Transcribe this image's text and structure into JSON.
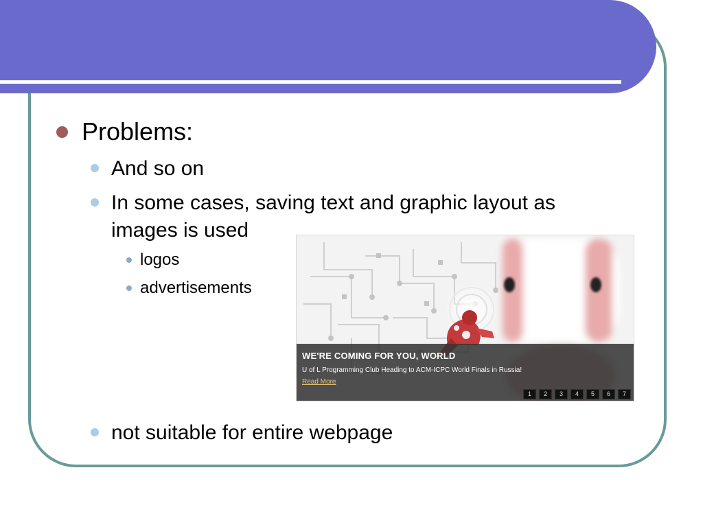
{
  "slide": {
    "bullets": {
      "problems": "Problems:",
      "and_so_on": "And so on",
      "images_used": "In some cases, saving text and graphic layout as images is used",
      "logos": "logos",
      "advertisements": "advertisements",
      "not_suitable": "not suitable for entire webpage"
    },
    "colors": {
      "title_band": "#6a6acc",
      "frame_border": "#6a9a9a",
      "level1_bullet": "#a05a5a",
      "level2_bullet": "#a9cce8"
    }
  },
  "banner": {
    "headline": "WE'RE COMING FOR YOU, WORLD",
    "subtext": "U of L Programming Club Heading to ACM-ICPC World Finals in Russia!",
    "link_label": "Read More",
    "pages": [
      "1",
      "2",
      "3",
      "4",
      "5",
      "6",
      "7"
    ]
  }
}
